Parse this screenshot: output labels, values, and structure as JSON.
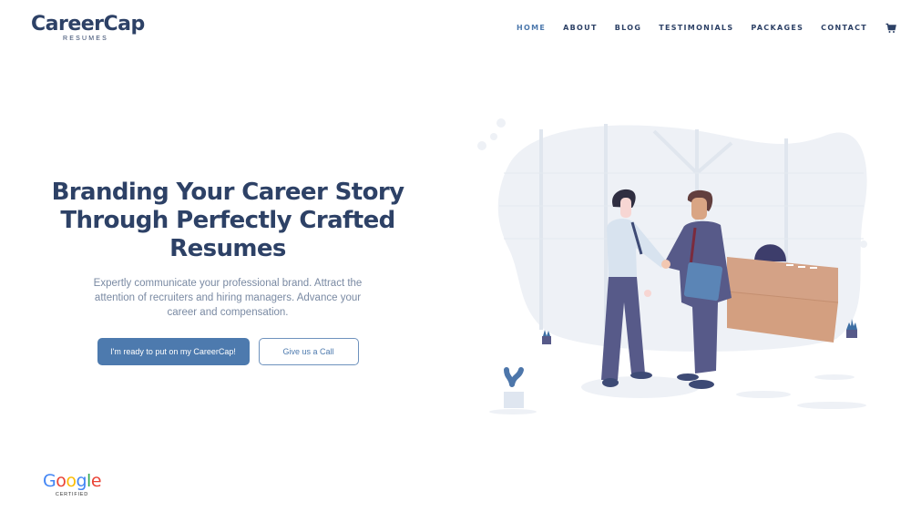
{
  "brand": {
    "name": "CareerCap",
    "tagline": "RESUMES"
  },
  "nav": {
    "items": [
      {
        "label": "HOME",
        "active": true
      },
      {
        "label": "ABOUT",
        "active": false
      },
      {
        "label": "BLOG",
        "active": false
      },
      {
        "label": "TESTIMONIALS",
        "active": false
      },
      {
        "label": "PACKAGES",
        "active": false
      },
      {
        "label": "CONTACT",
        "active": false
      }
    ],
    "cart_icon": "shopping-cart-icon"
  },
  "hero": {
    "title_lines": [
      "Branding Your Career Story",
      "Through Perfectly Crafted",
      "Resumes"
    ],
    "subtitle": "Expertly communicate your professional brand. Attract the attention of recruiters and hiring managers. Advance your career and compensation.",
    "primary_button": "I'm ready to put on my CareerCap!",
    "secondary_button": "Give us a Call"
  },
  "badge": {
    "letters": [
      "G",
      "o",
      "o",
      "g",
      "l",
      "e"
    ],
    "caption": "CERTIFIED"
  },
  "colors": {
    "brand_navy": "#2d4166",
    "accent_blue": "#4d7aae",
    "text_muted": "#7a8aa3"
  },
  "illustration": {
    "description": "two-businessmen-handshake-office"
  }
}
